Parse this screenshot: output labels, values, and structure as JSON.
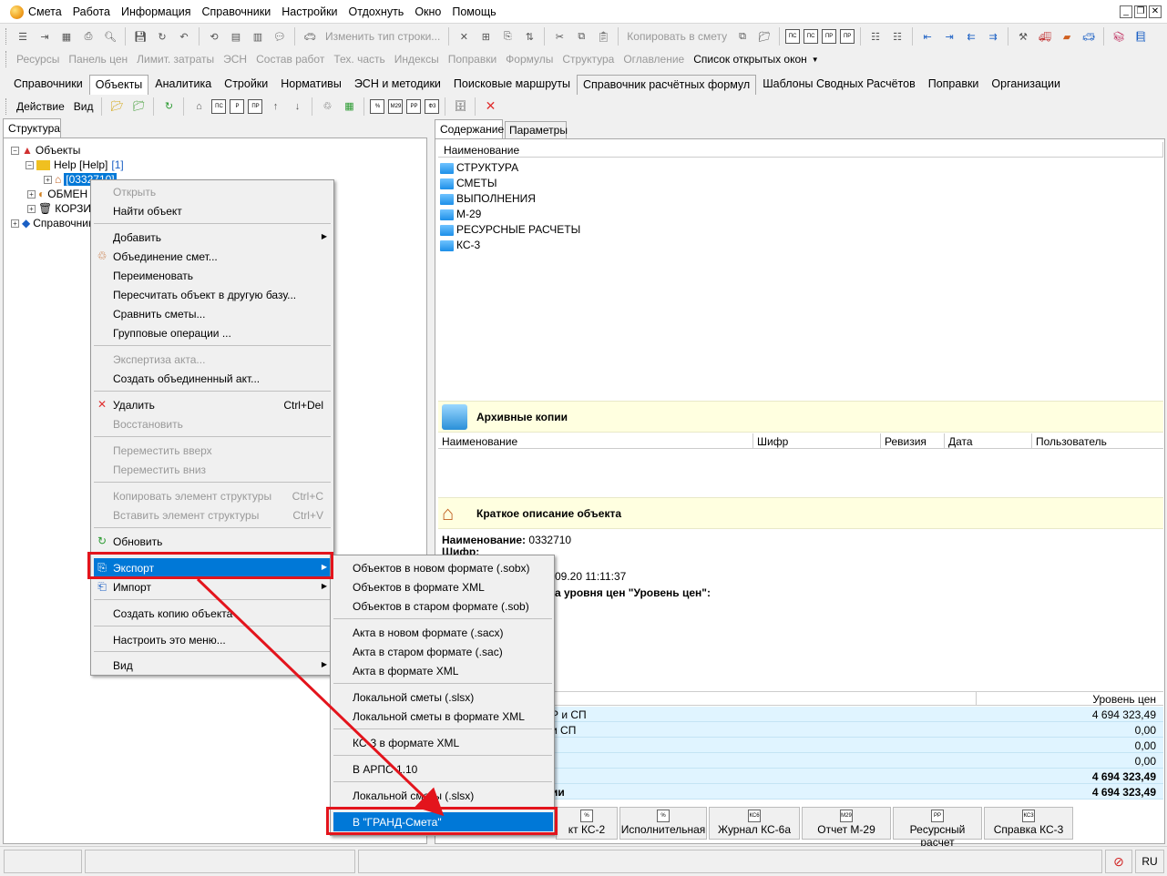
{
  "menubar": {
    "items": [
      "Смета",
      "Работа",
      "Информация",
      "Справочники",
      "Настройки",
      "Отдохнуть",
      "Окно",
      "Помощь"
    ]
  },
  "toolbar1": {
    "change_type": "Изменить тип строки...",
    "copy_to_estimate": "Копировать в смету"
  },
  "toolbar2": {
    "items": [
      "Ресурсы",
      "Панель цен",
      "Лимит. затраты",
      "ЭСН",
      "Состав работ",
      "Тех. часть",
      "Индексы",
      "Поправки",
      "Формулы",
      "Структура",
      "Оглавление",
      "Список открытых окон"
    ]
  },
  "tabs": {
    "items": [
      "Справочники",
      "Объекты",
      "Аналитика",
      "Стройки",
      "Нормативы",
      "ЭСН и методики",
      "Поисковые маршруты",
      "Справочник расчётных формул",
      "Шаблоны Сводных Расчётов",
      "Поправки",
      "Организации"
    ]
  },
  "toolbar3": {
    "action": "Действие",
    "view": "Вид"
  },
  "left_panel": {
    "tab": "Структура",
    "tree": {
      "root": "Объекты",
      "help": "Help [Help]",
      "help_count": "[1]",
      "selected": "[0332710]",
      "obmen": "ОБМЕН",
      "korz": "КОРЗИНА",
      "sprav": "Справочники"
    }
  },
  "right_panel": {
    "tabs": [
      "Содержание",
      "Параметры"
    ],
    "name_header": "Наименование",
    "folders": [
      "СТРУКТУРА",
      "СМЕТЫ",
      "ВЫПОЛНЕНИЯ",
      "М-29",
      "РЕСУРСНЫЕ РАСЧЕТЫ",
      "КС-3"
    ],
    "archive": {
      "title": "Архивные копии",
      "columns": [
        "Наименование",
        "Шифр",
        "Ревизия",
        "Дата",
        "Пользователь"
      ]
    },
    "description": {
      "title": "Краткое описание объекта",
      "name_label": "Наименование:",
      "name_value": "0332710",
      "code_label": "Шифр:",
      "date_fragment": "09.20 11:11:37",
      "price_level_fragment": "а уровня цен \"Уровень цен\":"
    },
    "summary": {
      "level_header": "Уровень цен",
      "rows": [
        {
          "label": "Р и СП",
          "value": "4 694 323,49",
          "bold": false
        },
        {
          "label": "и СП",
          "value": "0,00",
          "bold": false
        },
        {
          "label": "",
          "value": "0,00",
          "bold": false
        },
        {
          "label": "",
          "value": "0,00",
          "bold": false
        },
        {
          "label": "",
          "value": "4 694 323,49",
          "bold": true
        },
        {
          "label": "ии",
          "value": "4 694 323,49",
          "bold": true
        }
      ]
    },
    "bottom_buttons": [
      "кт КС-2",
      "Исполнительная",
      "Журнал КС-6а",
      "Отчет М-29",
      "Ресурсный расчет",
      "Справка КС-3"
    ],
    "bottom_icons": [
      "%",
      "%",
      "КС6",
      "М29",
      "РР",
      "КС3"
    ]
  },
  "context_menu": {
    "open": "Открыть",
    "find": "Найти объект",
    "add": "Добавить",
    "merge": "Объединение смет...",
    "rename": "Переименовать",
    "recalc": "Пересчитать объект в другую базу...",
    "compare": "Сравнить сметы...",
    "group_ops": "Групповые операции ...",
    "expertise": "Экспертиза акта...",
    "merged_act": "Создать объединенный акт...",
    "delete": "Удалить",
    "delete_sc": "Ctrl+Del",
    "restore": "Восстановить",
    "move_up": "Переместить вверх",
    "move_down": "Переместить вниз",
    "copy_struct": "Копировать элемент структуры",
    "copy_sc": "Ctrl+C",
    "paste_struct": "Вставить элемент структуры",
    "paste_sc": "Ctrl+V",
    "refresh": "Обновить",
    "export": "Экспорт",
    "import": "Импорт",
    "create_copy": "Создать копию объекта",
    "configure": "Настроить это меню...",
    "view": "Вид"
  },
  "export_submenu": {
    "items": [
      "Объектов в новом формате (.sobx)",
      "Объектов в формате XML",
      "Объектов в старом формате (.sob)",
      "Акта в новом формате (.sacx)",
      "Акта в старом формате (.sac)",
      "Акта в формате XML",
      "Локальной сметы (.slsx)",
      "Локальной сметы в формате XML",
      "КС-3 в формате XML",
      "В АРПС 1.10",
      "Локальной сметы (.slsx)",
      "В \"ГРАНД-Смета\""
    ]
  },
  "statusbar": {
    "lang": "RU"
  },
  "colors": {
    "highlight": "#0078d7",
    "annotation_red": "#e3141c",
    "info_yellow": "#ffffe0",
    "summary_blue": "#e0f4ff"
  }
}
